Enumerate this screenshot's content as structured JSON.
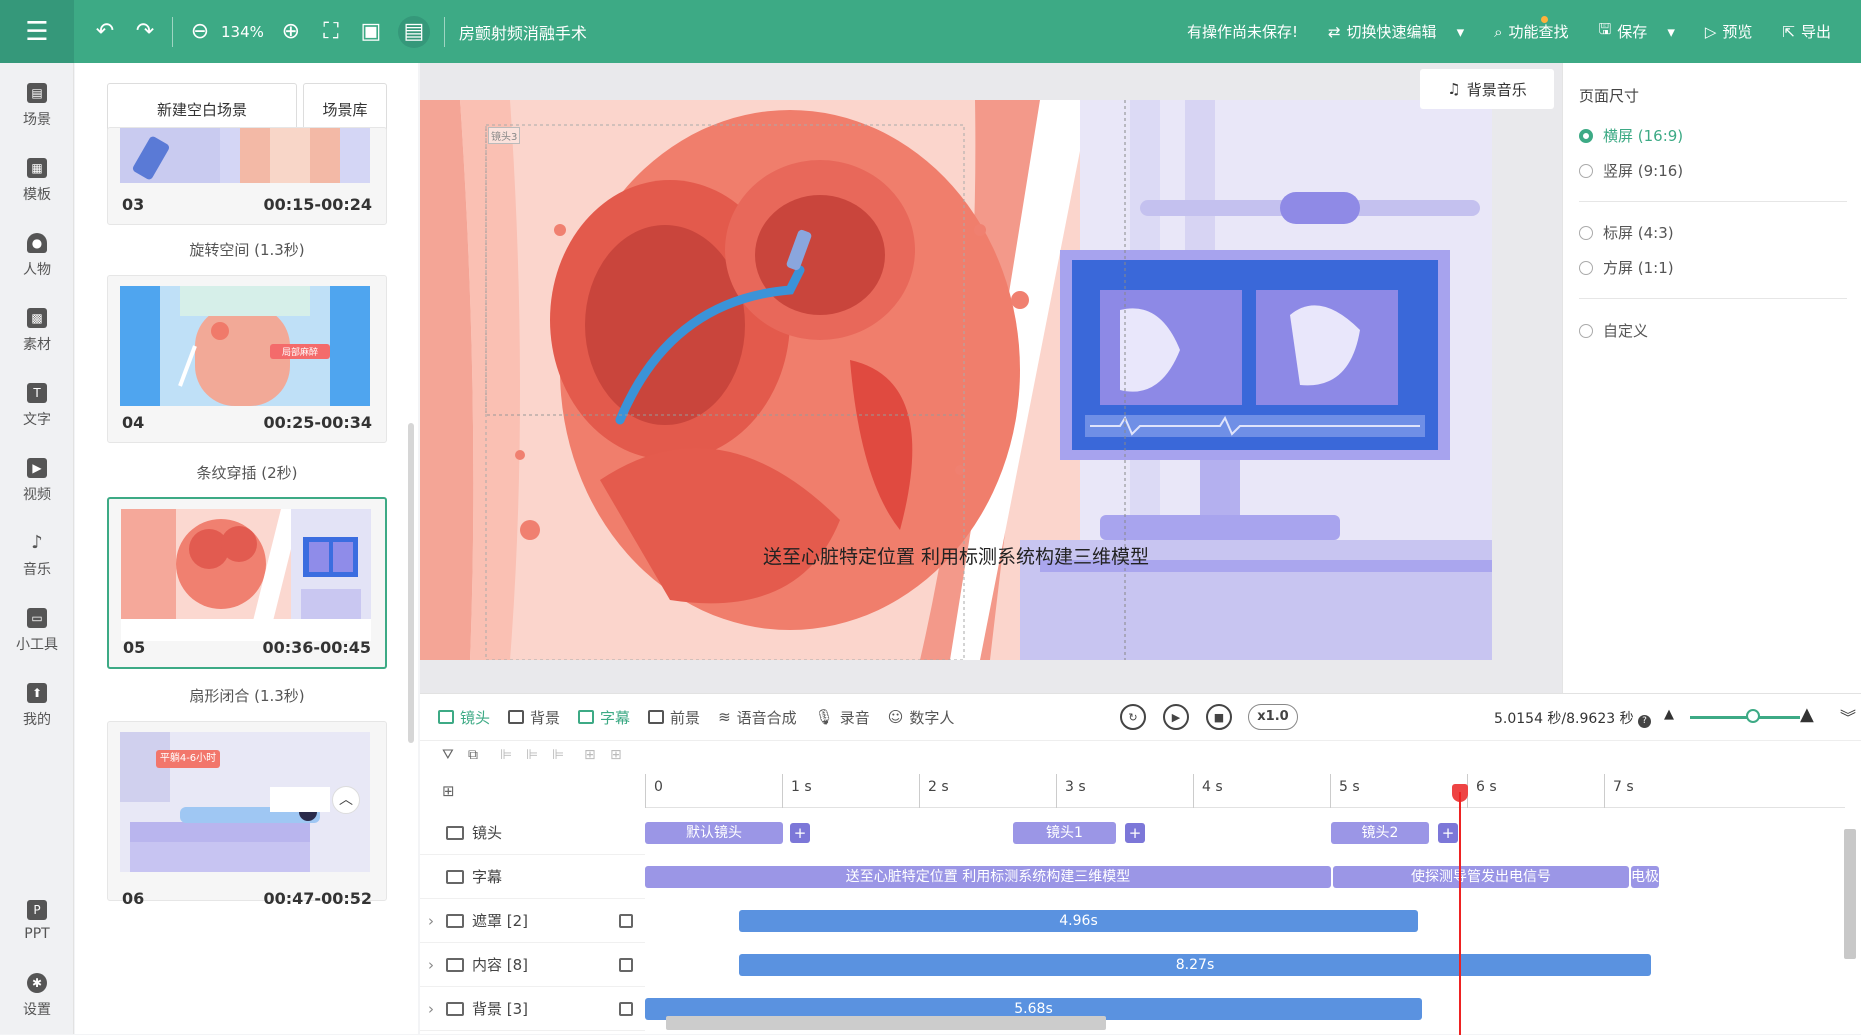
{
  "topbar": {
    "zoom": "134%",
    "title": "房颤射频消融手术",
    "unsaved": "有操作尚未保存!",
    "quick_edit": "切换快速编辑",
    "find": "功能查找",
    "save": "保存",
    "preview": "预览",
    "export": "导出"
  },
  "nav": [
    {
      "label": "场景",
      "icon": "scene-icon"
    },
    {
      "label": "模板",
      "icon": "template-icon"
    },
    {
      "label": "人物",
      "icon": "person-icon"
    },
    {
      "label": "素材",
      "icon": "material-icon"
    },
    {
      "label": "文字",
      "icon": "text-icon"
    },
    {
      "label": "视频",
      "icon": "video-icon"
    },
    {
      "label": "音乐",
      "icon": "music-icon"
    },
    {
      "label": "小工具",
      "icon": "tools-icon"
    },
    {
      "label": "我的",
      "icon": "mine-icon"
    },
    {
      "label": "PPT",
      "icon": "ppt-icon"
    },
    {
      "label": "设置",
      "icon": "settings-icon"
    }
  ],
  "scenes": {
    "new_blank": "新建空白场景",
    "library": "场景库",
    "items": [
      {
        "index": "03",
        "range": "00:15-00:24"
      },
      {
        "index": "04",
        "range": "00:25-00:34"
      },
      {
        "index": "05",
        "range": "00:36-00:45"
      },
      {
        "index": "06",
        "range": "00:47-00:52",
        "badge": "平躺4-6小时"
      }
    ],
    "transitions": [
      "旋转空间 (1.3秒)",
      "条纹穿插 (2秒)",
      "扇形闭合 (1.3秒)"
    ],
    "tag_04": "局部麻醉"
  },
  "canvas": {
    "bgm": "背景音乐",
    "lens_tag": "镜头3",
    "subtitle": "送至心脏特定位置 利用标测系统构建三维模型"
  },
  "page_size": {
    "title": "页面尺寸",
    "options": [
      "横屏 (16:9)",
      "竖屏 (9:16)",
      "标屏 (4:3)",
      "方屏 (1:1)",
      "自定义"
    ],
    "selected": "横屏 (16:9)"
  },
  "timeline": {
    "tabs": [
      "镜头",
      "背景",
      "字幕",
      "前景",
      "语音合成",
      "录音",
      "数字人"
    ],
    "speed": "x1.0",
    "time": "5.0154 秒/8.9623 秒",
    "ticks": [
      "0",
      "1 s",
      "2 s",
      "3 s",
      "4 s",
      "5 s",
      "6 s",
      "7 s"
    ],
    "tracks": [
      {
        "label": "镜头"
      },
      {
        "label": "字幕"
      },
      {
        "label": "遮罩 [2]"
      },
      {
        "label": "内容 [8]"
      },
      {
        "label": "背景 [3]"
      }
    ],
    "lens_clips": [
      "默认镜头",
      "镜头1",
      "镜头2"
    ],
    "sub_clips": [
      "送至心脏特定位置 利用标测系统构建三维模型",
      "使探测导管发出电信号",
      "电极"
    ],
    "bars": [
      "4.96s",
      "8.27s",
      "5.68s"
    ]
  },
  "colors": {
    "brand": "#3daa85",
    "clip_purple": "#9b96e6",
    "clip_blue": "#5a92e0",
    "playhead": "#ee2222"
  }
}
